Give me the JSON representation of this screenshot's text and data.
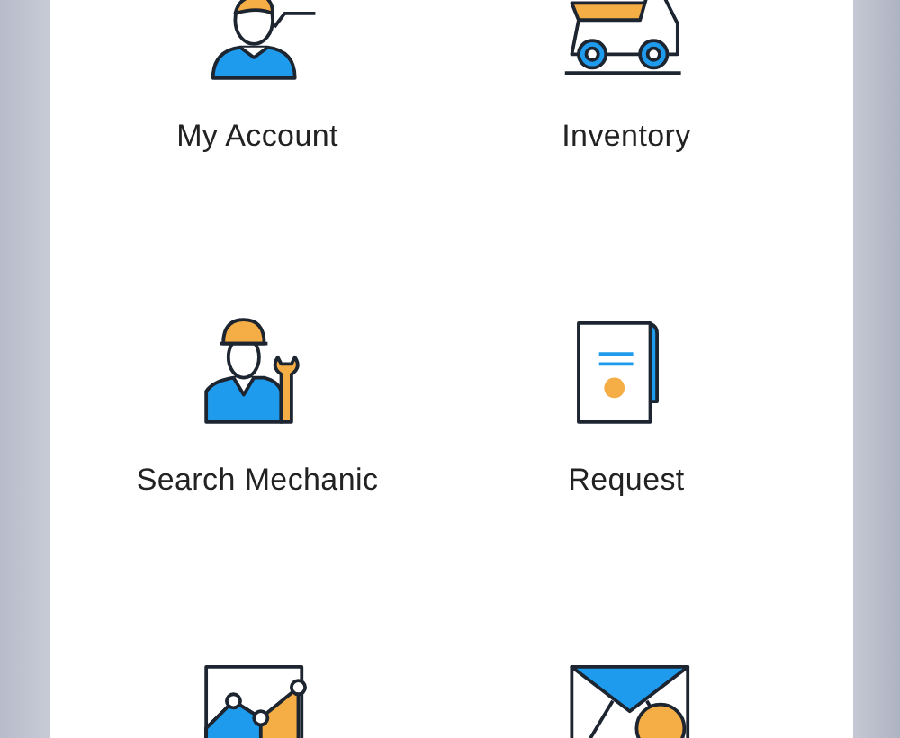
{
  "menu_tiles": [
    {
      "kind": "person",
      "label": "My Account"
    },
    {
      "kind": "truck",
      "label": "Inventory"
    },
    {
      "kind": "mechanic",
      "label": "Search Mechanic"
    },
    {
      "kind": "document",
      "label": "Request"
    },
    {
      "kind": "chart"
    },
    {
      "kind": "mail"
    }
  ]
}
